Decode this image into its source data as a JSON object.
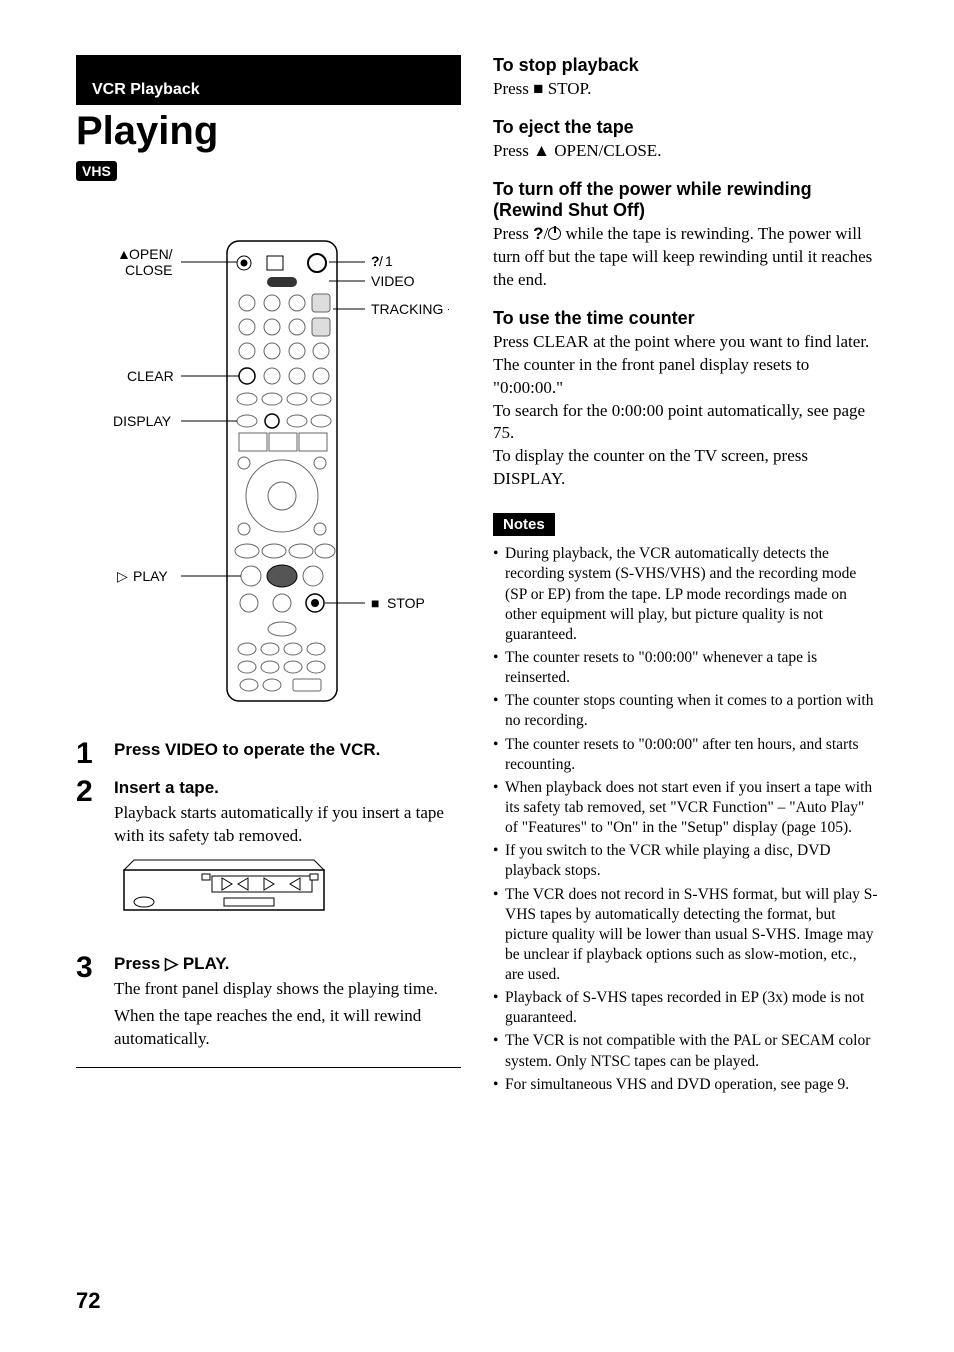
{
  "left": {
    "section_bar": "VCR Playback",
    "title": "Playing",
    "badge": "VHS",
    "remote_labels": {
      "open_close_1": "OPEN/",
      "open_close_2": "CLOSE",
      "power": "VIDEO",
      "io_symbol": "?/1",
      "tracking": "TRACKING +/–",
      "clear": "CLEAR",
      "display": "DISPLAY",
      "play": "PLAY",
      "stop": "STOP"
    },
    "steps": [
      {
        "num": "1",
        "head": "Press VIDEO to operate the VCR.",
        "body": []
      },
      {
        "num": "2",
        "head": "Insert a tape.",
        "body": [
          "Playback starts automatically if you insert a tape with its safety tab removed."
        ],
        "has_illus": true
      },
      {
        "num": "3",
        "head": "Press ▷ PLAY.",
        "body": [
          "The front panel display shows the playing time.",
          "When the tape reaches the end, it will rewind automatically."
        ]
      }
    ]
  },
  "right": {
    "sections": [
      {
        "head": "To stop playback",
        "body": "Press ■ STOP."
      },
      {
        "head": "To eject the tape",
        "body": "Press ▲ OPEN/CLOSE."
      },
      {
        "head": "To turn off the power while rewinding (Rewind Shut Off)",
        "body": "Press ?/1 while the tape is rewinding. The power will turn off but the tape will keep rewinding until it reaches the end."
      },
      {
        "head": "To use the time counter",
        "body": "Press CLEAR at the point where you want to find later. The counter in the front panel display resets to \"0:00:00.\"\nTo search for the 0:00:00 point automatically, see page 75.\nTo display the counter on the TV screen, press DISPLAY."
      }
    ],
    "notes_label": "Notes",
    "notes": [
      "During playback, the VCR automatically detects the recording system (S-VHS/VHS) and the recording mode (SP or EP) from the tape. LP mode recordings made on other equipment will play, but picture quality is not guaranteed.",
      "The counter resets to \"0:00:00\" whenever a tape is reinserted.",
      "The counter stops counting when it comes to a portion with no recording.",
      "The counter resets to \"0:00:00\" after ten hours, and starts recounting.",
      "When playback does not start even if you insert a tape with its safety tab removed, set \"VCR Function\" – \"Auto Play\" of \"Features\" to \"On\" in the \"Setup\" display (page 105).",
      "If you switch to the VCR while playing a disc, DVD playback stops.",
      "The VCR does not record in S-VHS format, but will play S-VHS tapes by automatically detecting the format, but picture quality will be lower than usual S-VHS. Image may be unclear if playback options such as slow-motion, etc., are used.",
      "Playback of S-VHS tapes recorded in EP (3x) mode is not guaranteed.",
      "The VCR is not compatible with the PAL or SECAM color system. Only NTSC tapes can be played.",
      "For simultaneous VHS and DVD operation, see page 9."
    ]
  },
  "page_number": "72"
}
